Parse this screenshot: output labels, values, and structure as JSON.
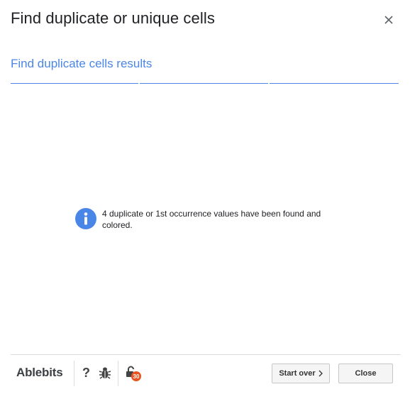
{
  "dialog": {
    "title": "Find duplicate or unique cells",
    "close_icon": "close-icon"
  },
  "results": {
    "heading": "Find duplicate cells results",
    "step_count": 3,
    "accent_color": "#4a86e8"
  },
  "message": {
    "icon": "info-icon",
    "text": "4 duplicate or 1st occurrence values have been found and colored."
  },
  "footer": {
    "brand": "Ablebits",
    "help_label": "?",
    "help_icon": "question-icon",
    "bug_icon": "bug-icon",
    "unlock_icon": "unlock-icon",
    "unlock_badge": "30",
    "start_over_label": "Start over",
    "start_over_icon": "chevron-right-icon",
    "close_label": "Close"
  }
}
